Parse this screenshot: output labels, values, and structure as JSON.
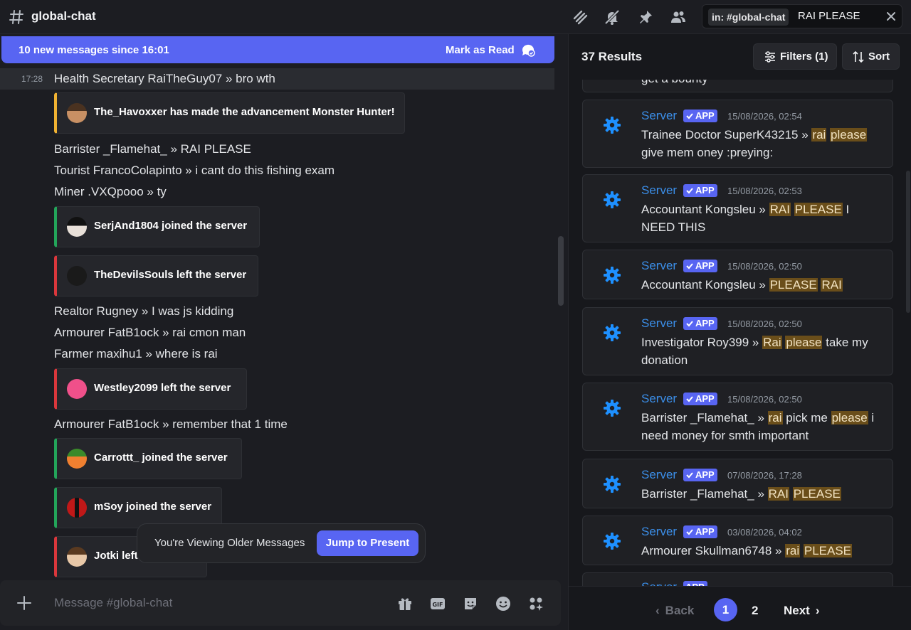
{
  "header": {
    "channel_name": "global-chat"
  },
  "search": {
    "scope_chip": "in: #global-chat",
    "query": "RAI PLEASE"
  },
  "banner": {
    "text": "10 new messages since 16:01",
    "mark_read": "Mark as Read"
  },
  "messages": {
    "m1": {
      "time": "17:28",
      "text": "Health Secretary RaiTheGuy07 » bro wth"
    },
    "e1": "The_Havoxxer has made the advancement Monster Hunter!",
    "m2": "Barrister _Flamehat_ » RAI PLEASE",
    "m3": "Tourist FrancoColapinto » i cant do this fishing exam",
    "m4": "Miner .VXQpooo » ty",
    "e2": "SerjAnd1804 joined the server",
    "e3": "TheDevilsSouls left the server",
    "m5": "Realtor Rugney » I was js kidding",
    "m6": "Armourer FatB1ock » rai cmon man",
    "m7": "Farmer maxihu1 » where is rai",
    "e4": "Westley2099 left the server",
    "m8": "Armourer FatB1ock » remember that 1 time",
    "e5": "Carrottt_ joined the server",
    "e6": "mSoy joined the server",
    "e7": "Jotki left the server"
  },
  "older_bar": {
    "text": "You're Viewing Older Messages",
    "jump": "Jump to Present"
  },
  "composer": {
    "placeholder": "Message #global-chat"
  },
  "sidebar": {
    "result_count": "37 Results",
    "filters": "Filters (1)",
    "sort": "Sort",
    "partial_top": "get a bounty",
    "results": [
      {
        "author": "Server",
        "badge": "APP",
        "date": "15/08/2026, 02:54",
        "parts": [
          "Trainee Doctor SuperK43215 » ",
          "rai",
          " ",
          "please",
          " give mem oney :preying:"
        ]
      },
      {
        "author": "Server",
        "badge": "APP",
        "date": "15/08/2026, 02:53",
        "parts": [
          "Accountant Kongsleu » ",
          "RAI",
          " ",
          "PLEASE",
          " I NEED THIS"
        ]
      },
      {
        "author": "Server",
        "badge": "APP",
        "date": "15/08/2026, 02:50",
        "parts": [
          "Accountant Kongsleu » ",
          "PLEASE",
          " ",
          "RAI",
          ""
        ]
      },
      {
        "author": "Server",
        "badge": "APP",
        "date": "15/08/2026, 02:50",
        "parts": [
          "Investigator Roy399 » ",
          "Rai",
          " ",
          "please",
          " take my donation"
        ]
      },
      {
        "author": "Server",
        "badge": "APP",
        "date": "15/08/2026, 02:50",
        "parts": [
          "Barrister _Flamehat_ » ",
          "rai",
          " pick me ",
          "please",
          " i need money for smth important"
        ]
      },
      {
        "author": "Server",
        "badge": "APP",
        "date": "07/08/2026, 17:28",
        "parts": [
          "Barrister _Flamehat_ » ",
          "RAI",
          " ",
          "PLEASE",
          ""
        ]
      },
      {
        "author": "Server",
        "badge": "APP",
        "date": "03/08/2026, 04:02",
        "parts": [
          "Armourer Skullman6748 » ",
          "rai",
          " ",
          "PLEASE",
          ""
        ]
      }
    ],
    "pager": {
      "back": "Back",
      "page1": "1",
      "page2": "2",
      "next": "Next"
    }
  },
  "colors": {
    "accent": "#5865f2",
    "highlight": "#6a4e1a",
    "author": "#3b8ee8",
    "join": "#23a55a",
    "leave": "#da373c",
    "advancement": "#f0b232"
  }
}
